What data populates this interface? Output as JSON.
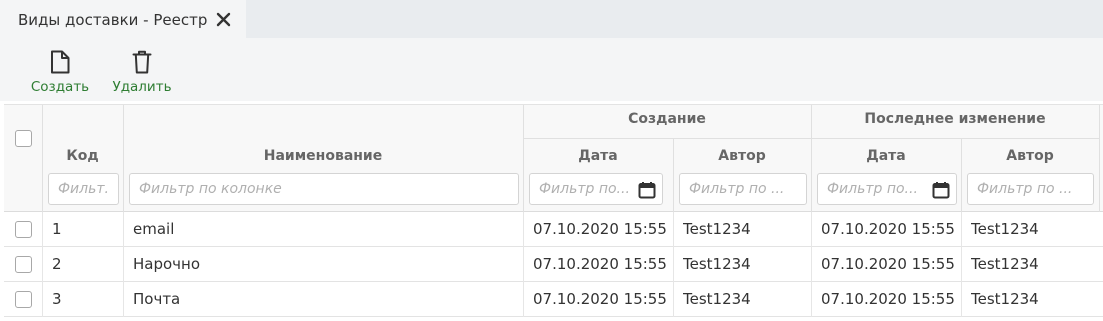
{
  "tab": {
    "title": "Виды доставки - Реестр"
  },
  "toolbar": {
    "create_label": "Создать",
    "delete_label": "Удалить"
  },
  "table": {
    "groups": {
      "creation": "Создание",
      "last_change": "Последнее изменение"
    },
    "columns": {
      "code": "Код",
      "name": "Наименование",
      "created_date": "Дата",
      "created_author": "Автор",
      "changed_date": "Дата",
      "changed_author": "Автор"
    },
    "filters": {
      "code": "Фильт...",
      "name": "Фильтр по колонке",
      "created_date": "Фильтр по...",
      "created_author": "Фильтр по ...",
      "changed_date": "Фильтр по...",
      "changed_author": "Фильтр по ..."
    },
    "rows": [
      {
        "code": "1",
        "name": "email",
        "created_date": "07.10.2020 15:55",
        "created_author": "Test1234",
        "changed_date": "07.10.2020 15:55",
        "changed_author": "Test1234"
      },
      {
        "code": "2",
        "name": "Нарочно",
        "created_date": "07.10.2020 15:55",
        "created_author": "Test1234",
        "changed_date": "07.10.2020 15:55",
        "changed_author": "Test1234"
      },
      {
        "code": "3",
        "name": "Почта",
        "created_date": "07.10.2020 15:55",
        "created_author": "Test1234",
        "changed_date": "07.10.2020 15:55",
        "changed_author": "Test1234"
      }
    ]
  },
  "colors": {
    "accent_green": "#2e7d32",
    "tab_bar": "#e9ecef",
    "toolbar_bg": "#f4f5f6",
    "header_bg": "#f8f8f8"
  },
  "icons": {
    "close": "close-icon",
    "create": "document-icon",
    "delete": "trash-icon",
    "calendar": "calendar-icon"
  }
}
